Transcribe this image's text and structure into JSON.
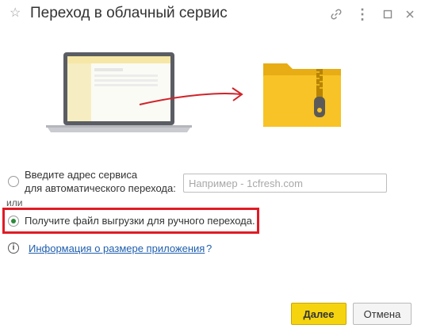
{
  "window": {
    "title": "Переход в облачный сервис",
    "star_icon": "star-icon",
    "link_icon": "link-icon",
    "more_icon": "more-icon",
    "maximize_icon": "maximize-icon",
    "close_icon": "close-icon"
  },
  "illustration": {
    "laptop_icon": "laptop-illustration",
    "arrow_icon": "arrow-illustration",
    "folder_icon": "zip-folder-illustration",
    "arrow_color": "#d0232a",
    "folder_color": "#f7c326"
  },
  "options": {
    "auto": {
      "label": "Введите адрес сервиса\nдля автоматического перехода:",
      "selected": false,
      "input_value": "",
      "input_placeholder": "Например - 1cfresh.com"
    },
    "separator": "или",
    "manual": {
      "label": "Получите файл выгрузки для ручного перехода.",
      "selected": true
    }
  },
  "info": {
    "icon": "info-icon",
    "link_label": "Информация о размере приложения",
    "help_label": "?"
  },
  "buttons": {
    "next_label": "Далее",
    "cancel_label": "Отмена"
  },
  "colors": {
    "accent_button": "#f5d40f",
    "highlight_border": "#e01b24",
    "link": "#1f5fae",
    "radio_selected": "#2c8a3a"
  }
}
